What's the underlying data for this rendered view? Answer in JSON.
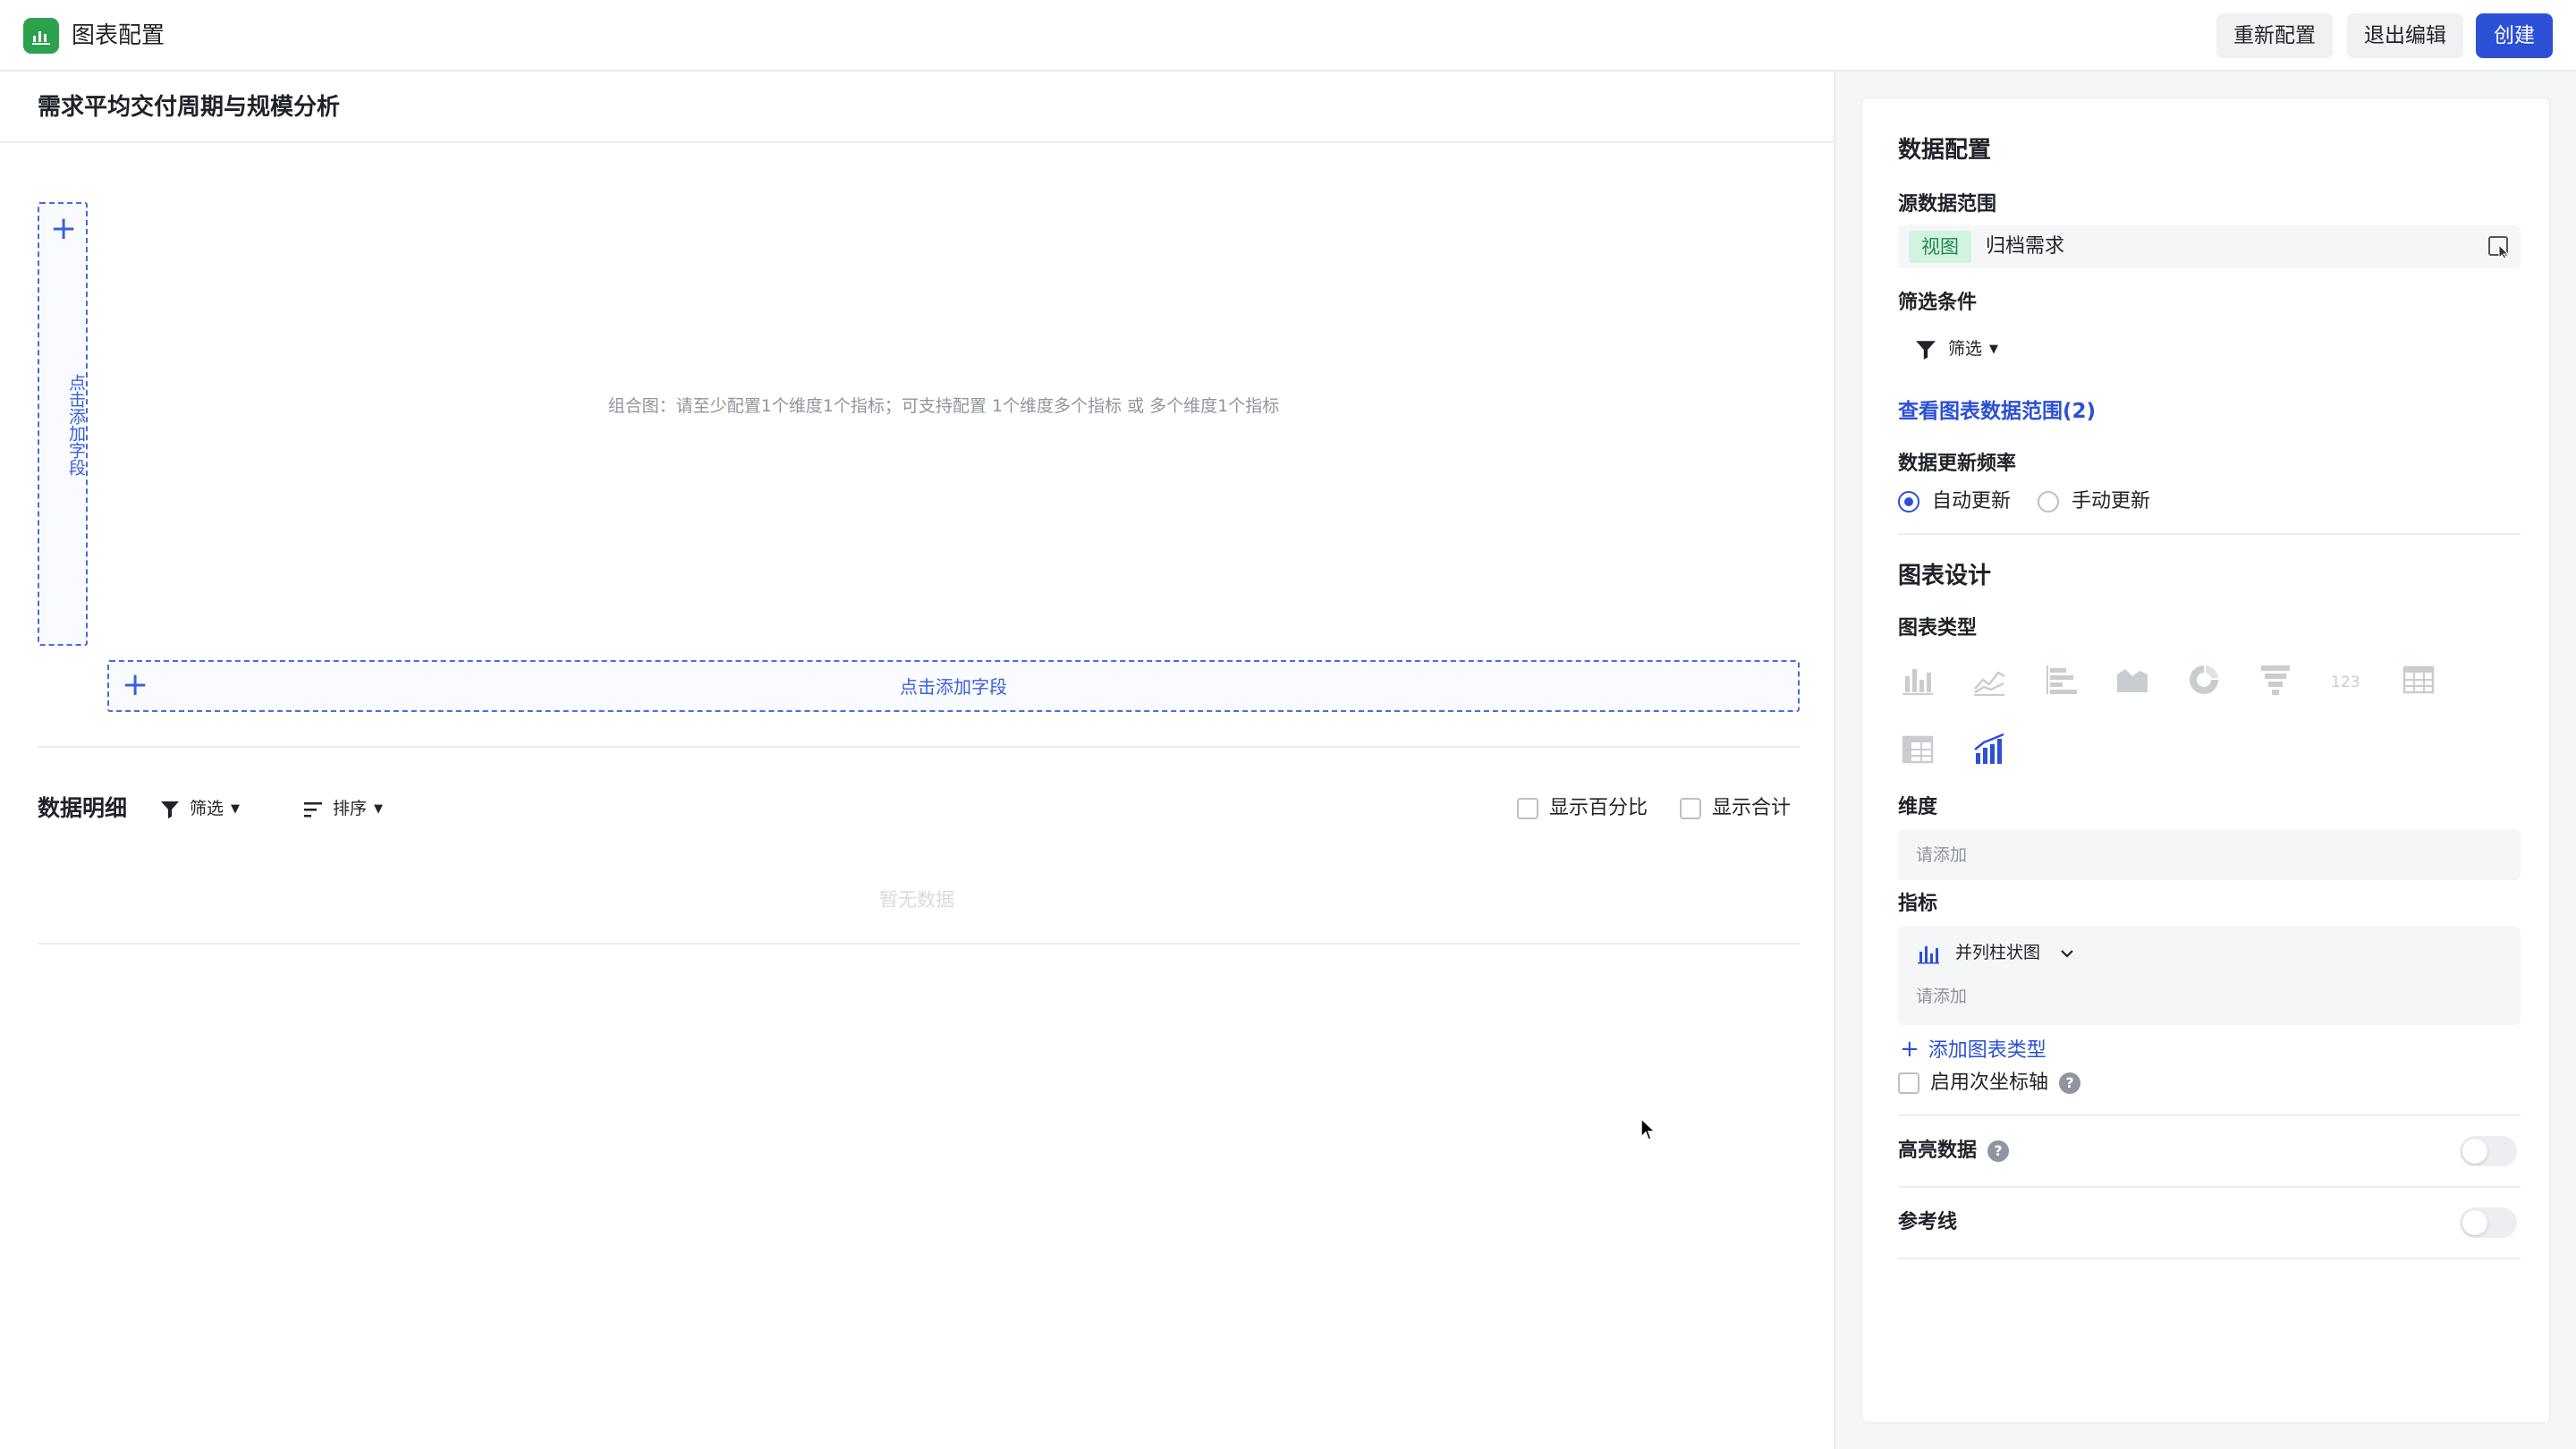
{
  "header": {
    "title": "图表配置",
    "buttons": {
      "reconfigure": "重新配置",
      "exit_edit": "退出编辑",
      "create": "创建"
    }
  },
  "main": {
    "chart_title": "需求平均交付周期与规模分析",
    "vertical_drop_label": "点击添加字段",
    "hint": "组合图：请至少配置1个维度1个指标；可支持配置 1个维度多个指标 或 多个维度1个指标",
    "horizontal_drop_label": "点击添加字段",
    "detail": {
      "title": "数据明细",
      "filter": "筛选",
      "sort": "排序",
      "show_percent": "显示百分比",
      "show_total": "显示合计",
      "empty": "暂无数据"
    }
  },
  "panel": {
    "data_config_title": "数据配置",
    "source_label": "源数据范围",
    "source_tag": "视图",
    "source_value": "归档需求",
    "filter_label": "筛选条件",
    "filter_button": "筛选",
    "view_range_link": "查看图表数据范围(2)",
    "update_freq_label": "数据更新频率",
    "auto_update": "自动更新",
    "manual_update": "手动更新",
    "chart_design_title": "图表设计",
    "chart_type_label": "图表类型",
    "chart_types": [
      "bar-chart-icon",
      "line-chart-icon",
      "horizontal-bar-icon",
      "area-chart-icon",
      "pie-chart-icon",
      "funnel-icon",
      "number-card-icon",
      "table-icon",
      "pivot-table-icon",
      "combo-chart-icon"
    ],
    "dimension_label": "维度",
    "dimension_placeholder": "请添加",
    "metric_label": "指标",
    "metric_chart_type": "并列柱状图",
    "metric_placeholder": "请添加",
    "add_chart_type": "添加图表类型",
    "secondary_axis": "启用次坐标轴",
    "highlight_label": "高亮数据",
    "reference_line_label": "参考线"
  },
  "colors": {
    "primary": "#2b50d6",
    "logo": "#2ea14d",
    "tag_bg": "#d3f3e1",
    "tag_text": "#1e8a4c"
  }
}
